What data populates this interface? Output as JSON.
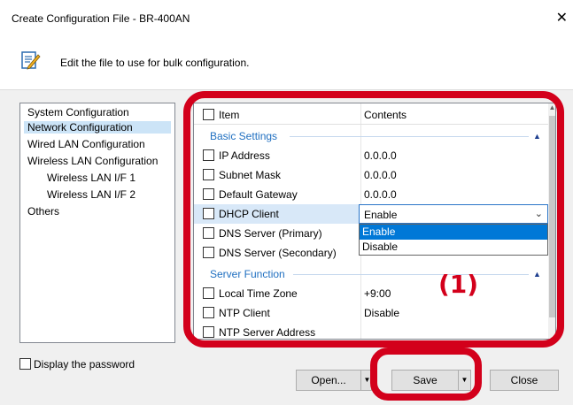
{
  "window": {
    "title": "Create Configuration File - BR-400AN",
    "description": "Edit the file to use for bulk configuration."
  },
  "tree": {
    "items": [
      {
        "label": "System Configuration"
      },
      {
        "label": "Network Configuration",
        "selected": true
      },
      {
        "label": "Wired LAN Configuration"
      },
      {
        "label": "Wireless LAN Configuration"
      },
      {
        "label": "Wireless LAN I/F 1"
      },
      {
        "label": "Wireless LAN I/F 2"
      },
      {
        "label": "Others"
      }
    ]
  },
  "grid": {
    "header": {
      "item": "Item",
      "contents": "Contents"
    },
    "sections": [
      {
        "title": "Basic Settings",
        "rows": [
          {
            "item": "IP Address",
            "value": "0.0.0.0"
          },
          {
            "item": "Subnet Mask",
            "value": "0.0.0.0"
          },
          {
            "item": "Default Gateway",
            "value": "0.0.0.0"
          },
          {
            "item": "DHCP Client",
            "value": "Enable"
          },
          {
            "item": "DNS Server (Primary)",
            "value": ""
          },
          {
            "item": "DNS Server (Secondary)",
            "value": ""
          }
        ]
      },
      {
        "title": "Server Function",
        "rows": [
          {
            "item": "Local Time Zone",
            "value": "+9:00"
          },
          {
            "item": "NTP Client",
            "value": "Disable"
          },
          {
            "item": "NTP Server Address",
            "value": ""
          }
        ]
      }
    ],
    "dropdown": {
      "options": [
        "Enable",
        "Disable"
      ],
      "selected": "Enable"
    }
  },
  "footer": {
    "password_label": "Display the password",
    "open_label": "Open...",
    "save_label": "Save",
    "close_label": "Close"
  },
  "annotation": {
    "label": "(1)"
  },
  "colors": {
    "annotation": "#d3001b",
    "selection": "#0078d7",
    "section": "#1f6fc0"
  },
  "icons": [
    "edit-document-icon",
    "close-icon",
    "chevron-down-icon",
    "collapse-caret-icon"
  ]
}
